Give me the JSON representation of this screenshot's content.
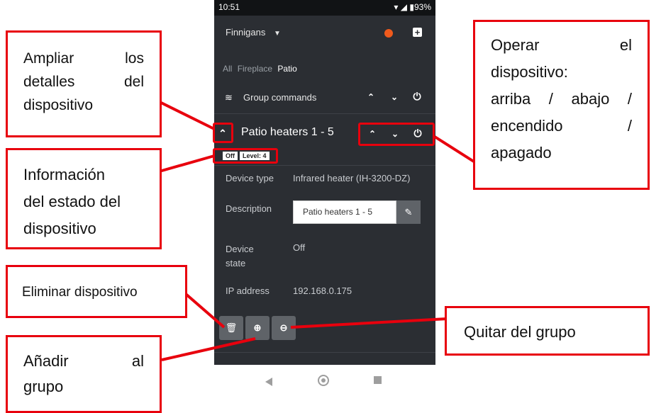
{
  "status": {
    "time": "10:51",
    "battery": "93%"
  },
  "header": {
    "app_name": "Finnigans"
  },
  "tabs": [
    "All",
    "Fireplace",
    "Patio"
  ],
  "group": {
    "label": "Group commands"
  },
  "device": {
    "title": "Patio heaters 1 - 5",
    "state_badge": "Off",
    "level_badge": "Level: 4",
    "rows": {
      "type_label": "Device type",
      "type_value": "Infrared heater (IH-3200-DZ)",
      "desc_label": "Description",
      "desc_value": "Patio heaters 1 - 5",
      "state_label": "Device state",
      "state_value": "Off",
      "ip_label": "IP address",
      "ip_value": "192.168.0.175"
    }
  },
  "callouts": {
    "expand": [
      "Ampliar los",
      "detalles del",
      "dispositivo"
    ],
    "info": [
      "Información",
      "del estado del",
      "dispositivo"
    ],
    "delete": "Eliminar dispositivo",
    "add": [
      "Añadir al",
      "grupo"
    ],
    "operate": [
      "Operar el",
      "dispositivo:",
      "arriba / abajo /",
      "encendido /",
      "apagado"
    ],
    "remove": "Quitar del grupo"
  },
  "colors": {
    "annotation_red": "#e8000d",
    "phone_bg": "#2b2e33"
  }
}
